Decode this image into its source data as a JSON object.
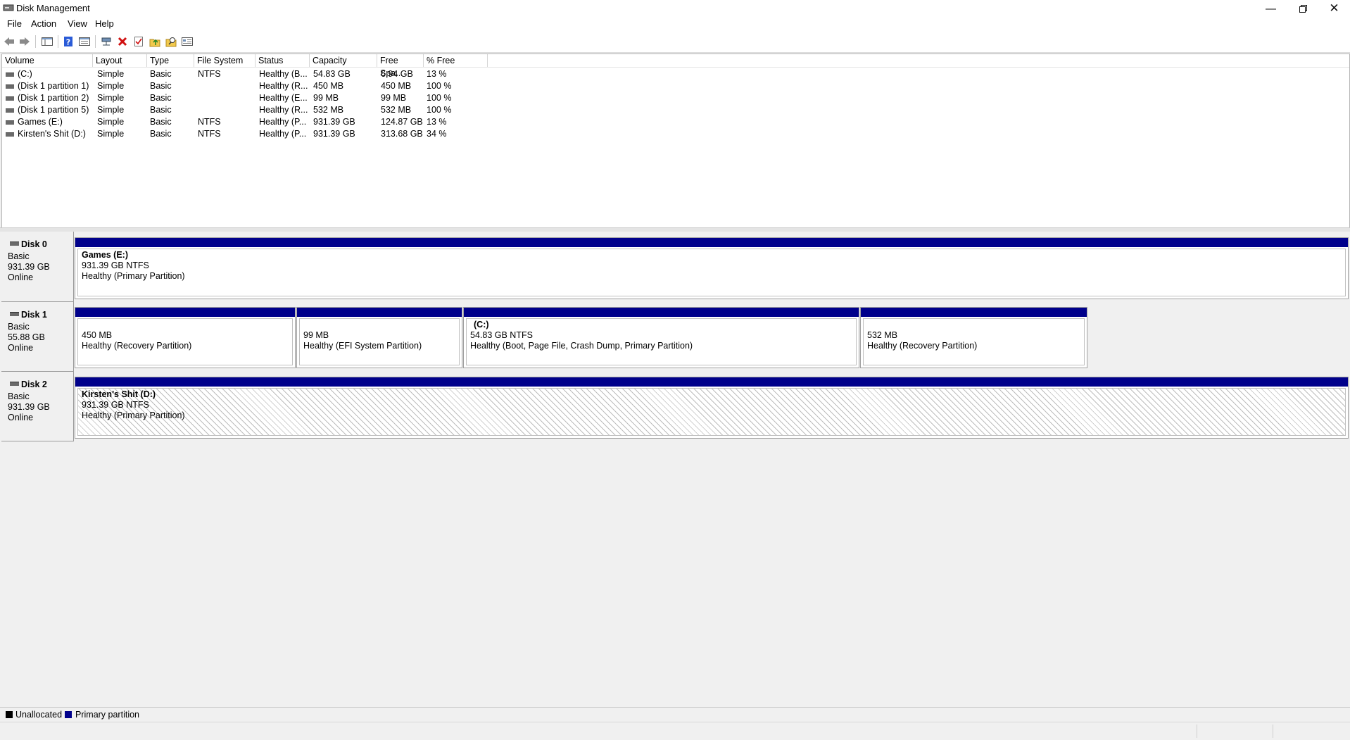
{
  "window": {
    "title": "Disk Management"
  },
  "menu": {
    "file": "File",
    "action": "Action",
    "view": "View",
    "help": "Help"
  },
  "toolbar": {
    "buttons": [
      "back-icon",
      "forward-icon",
      "console-tree-icon",
      "help-icon",
      "show-pane-icon",
      "connect-icon",
      "delete-icon",
      "check-icon",
      "rescan-icon",
      "search-icon",
      "properties-icon"
    ]
  },
  "columns": [
    "Volume",
    "Layout",
    "Type",
    "File System",
    "Status",
    "Capacity",
    "Free Spa...",
    "% Free"
  ],
  "volumes": [
    {
      "volume": "(C:)",
      "layout": "Simple",
      "type": "Basic",
      "fs": "NTFS",
      "status": "Healthy (B...",
      "capacity": "54.83 GB",
      "free": "6.94 GB",
      "pct": "13 %"
    },
    {
      "volume": "(Disk 1 partition 1)",
      "layout": "Simple",
      "type": "Basic",
      "fs": "",
      "status": "Healthy (R...",
      "capacity": "450 MB",
      "free": "450 MB",
      "pct": "100 %"
    },
    {
      "volume": "(Disk 1 partition 2)",
      "layout": "Simple",
      "type": "Basic",
      "fs": "",
      "status": "Healthy (E...",
      "capacity": "99 MB",
      "free": "99 MB",
      "pct": "100 %"
    },
    {
      "volume": "(Disk 1 partition 5)",
      "layout": "Simple",
      "type": "Basic",
      "fs": "",
      "status": "Healthy (R...",
      "capacity": "532 MB",
      "free": "532 MB",
      "pct": "100 %"
    },
    {
      "volume": "Games (E:)",
      "layout": "Simple",
      "type": "Basic",
      "fs": "NTFS",
      "status": "Healthy (P...",
      "capacity": "931.39 GB",
      "free": "124.87 GB",
      "pct": "13 %"
    },
    {
      "volume": "Kirsten's Shit (D:)",
      "layout": "Simple",
      "type": "Basic",
      "fs": "NTFS",
      "status": "Healthy (P...",
      "capacity": "931.39 GB",
      "free": "313.68 GB",
      "pct": "34 %"
    }
  ],
  "disks": [
    {
      "name": "Disk 0",
      "type": "Basic",
      "size": "931.39 GB",
      "state": "Online",
      "partitions": [
        {
          "title": "Games  (E:)",
          "size": "931.39 GB NTFS",
          "status": "Healthy (Primary Partition)"
        }
      ]
    },
    {
      "name": "Disk 1",
      "type": "Basic",
      "size": "55.88 GB",
      "state": "Online",
      "partitions": [
        {
          "title": "",
          "size": "450 MB",
          "status": "Healthy (Recovery Partition)"
        },
        {
          "title": "",
          "size": "99 MB",
          "status": "Healthy (EFI System Partition)"
        },
        {
          "title": "(C:)",
          "size": "54.83 GB NTFS",
          "status": "Healthy (Boot, Page File, Crash Dump, Primary Partition)"
        },
        {
          "title": "",
          "size": "532 MB",
          "status": "Healthy (Recovery Partition)"
        }
      ]
    },
    {
      "name": "Disk 2",
      "type": "Basic",
      "size": "931.39 GB",
      "state": "Online",
      "partitions": [
        {
          "title": "Kirsten's Shit  (D:)",
          "size": "931.39 GB NTFS",
          "status": "Healthy (Primary Partition)"
        }
      ]
    }
  ],
  "legend": {
    "unallocated": "Unallocated",
    "primary": "Primary partition",
    "unallocated_color": "#000000",
    "primary_color": "#00008b"
  }
}
